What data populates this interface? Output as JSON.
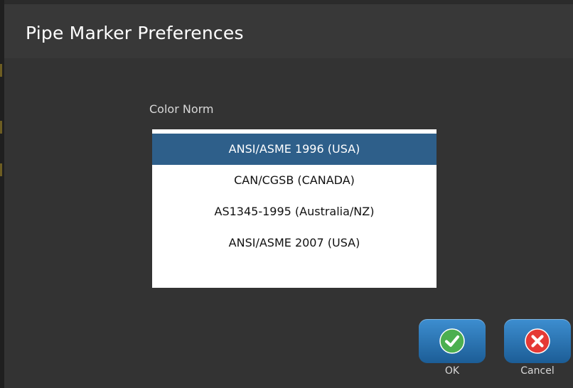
{
  "dialog": {
    "title": "Pipe Marker Preferences"
  },
  "color_norm": {
    "label": "Color Norm",
    "selected_index": 0,
    "options": [
      "ANSI/ASME 1996 (USA)",
      "CAN/CGSB (CANADA)",
      "AS1345-1995 (Australia/NZ)",
      "ANSI/ASME 2007 (USA)"
    ]
  },
  "buttons": {
    "ok_label": "OK",
    "ok_icon": "checkmark-icon",
    "cancel_label": "Cancel",
    "cancel_icon": "close-icon"
  },
  "colors": {
    "selection": "#2e5f8a",
    "ok_icon": "#4caf50",
    "cancel_icon": "#e53935"
  }
}
